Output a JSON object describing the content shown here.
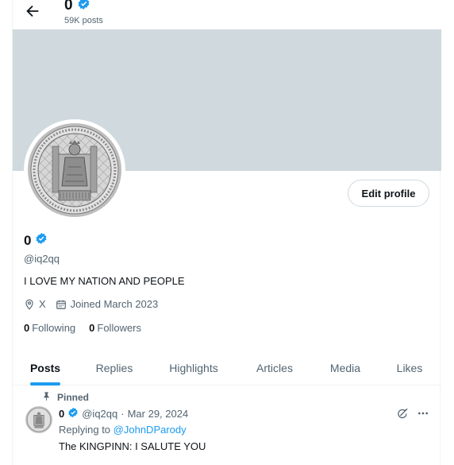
{
  "header": {
    "name": "0",
    "posts_count": "59K posts"
  },
  "profile": {
    "name": "0",
    "handle": "@iq2qq",
    "bio": "I LOVE MY NATION AND PEOPLE",
    "location": "X",
    "joined": "Joined March 2023",
    "following_count": "0",
    "following_label": "Following",
    "followers_count": "0",
    "followers_label": "Followers",
    "edit_label": "Edit profile",
    "verified_color": "#1d9bf0",
    "banner_color": "#cfd9de"
  },
  "tabs": [
    {
      "label": "Posts",
      "active": true
    },
    {
      "label": "Replies",
      "active": false
    },
    {
      "label": "Highlights",
      "active": false
    },
    {
      "label": "Articles",
      "active": false
    },
    {
      "label": "Media",
      "active": false
    },
    {
      "label": "Likes",
      "active": false
    }
  ],
  "tweet": {
    "pinned_label": "Pinned",
    "name": "0",
    "handle": "@iq2qq",
    "date": "Mar 29, 2024",
    "separator": "·",
    "replying_prefix": "Replying to",
    "replying_to": "@JohnDParody",
    "text": "The KINGPINN: I SALUTE YOU",
    "more_icon": "more-icon",
    "grok_icon": "grok-icon"
  }
}
